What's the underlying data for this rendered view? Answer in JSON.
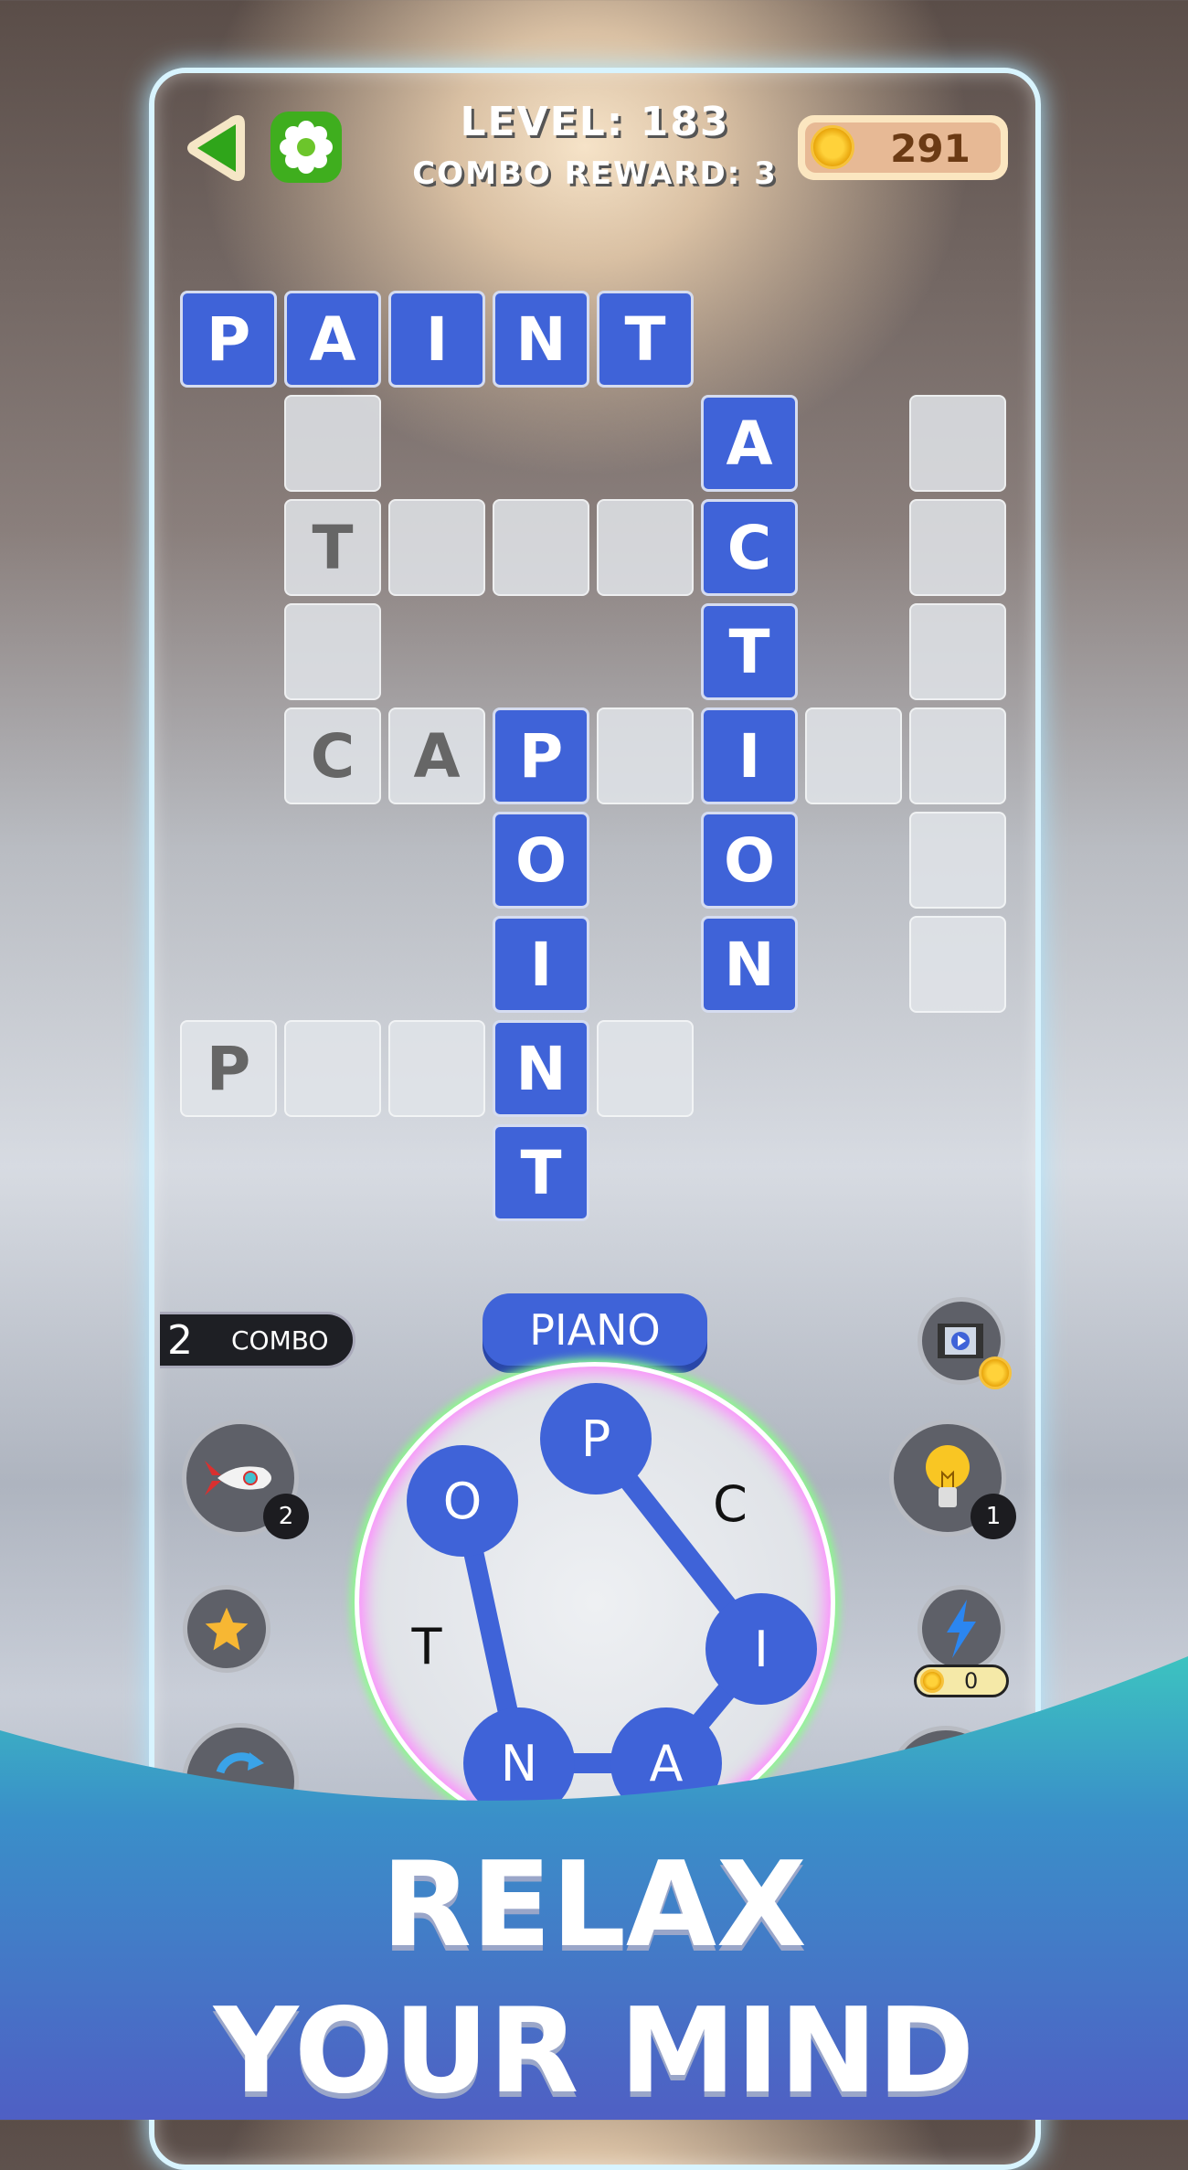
{
  "header": {
    "back_icon": "back-arrow-icon",
    "settings_icon": "gear-icon",
    "level": "LEVEL: 183",
    "combo_reward": "COMBO REWARD: 3",
    "coins": "291"
  },
  "grid": {
    "cells": [
      {
        "r": 0,
        "c": 0,
        "l": "P",
        "s": "filled"
      },
      {
        "r": 0,
        "c": 1,
        "l": "A",
        "s": "filled"
      },
      {
        "r": 0,
        "c": 2,
        "l": "I",
        "s": "filled"
      },
      {
        "r": 0,
        "c": 3,
        "l": "N",
        "s": "filled"
      },
      {
        "r": 0,
        "c": 4,
        "l": "T",
        "s": "filled"
      },
      {
        "r": 1,
        "c": 1,
        "l": "",
        "s": "empty"
      },
      {
        "r": 1,
        "c": 5,
        "l": "A",
        "s": "filled"
      },
      {
        "r": 1,
        "c": 7,
        "l": "",
        "s": "empty"
      },
      {
        "r": 2,
        "c": 1,
        "l": "T",
        "s": "hint"
      },
      {
        "r": 2,
        "c": 2,
        "l": "",
        "s": "empty"
      },
      {
        "r": 2,
        "c": 3,
        "l": "",
        "s": "empty"
      },
      {
        "r": 2,
        "c": 4,
        "l": "",
        "s": "empty"
      },
      {
        "r": 2,
        "c": 5,
        "l": "C",
        "s": "filled"
      },
      {
        "r": 2,
        "c": 7,
        "l": "",
        "s": "empty"
      },
      {
        "r": 3,
        "c": 1,
        "l": "",
        "s": "empty"
      },
      {
        "r": 3,
        "c": 5,
        "l": "T",
        "s": "filled"
      },
      {
        "r": 3,
        "c": 7,
        "l": "",
        "s": "empty"
      },
      {
        "r": 4,
        "c": 1,
        "l": "C",
        "s": "hint"
      },
      {
        "r": 4,
        "c": 2,
        "l": "A",
        "s": "hint"
      },
      {
        "r": 4,
        "c": 3,
        "l": "P",
        "s": "filled"
      },
      {
        "r": 4,
        "c": 4,
        "l": "",
        "s": "empty"
      },
      {
        "r": 4,
        "c": 5,
        "l": "I",
        "s": "filled"
      },
      {
        "r": 4,
        "c": 6,
        "l": "",
        "s": "empty"
      },
      {
        "r": 4,
        "c": 7,
        "l": "",
        "s": "empty"
      },
      {
        "r": 5,
        "c": 3,
        "l": "O",
        "s": "filled"
      },
      {
        "r": 5,
        "c": 5,
        "l": "O",
        "s": "filled"
      },
      {
        "r": 5,
        "c": 7,
        "l": "",
        "s": "empty"
      },
      {
        "r": 6,
        "c": 3,
        "l": "I",
        "s": "filled"
      },
      {
        "r": 6,
        "c": 5,
        "l": "N",
        "s": "filled"
      },
      {
        "r": 6,
        "c": 7,
        "l": "",
        "s": "empty"
      },
      {
        "r": 7,
        "c": 0,
        "l": "P",
        "s": "hint"
      },
      {
        "r": 7,
        "c": 1,
        "l": "",
        "s": "empty"
      },
      {
        "r": 7,
        "c": 2,
        "l": "",
        "s": "empty"
      },
      {
        "r": 7,
        "c": 3,
        "l": "N",
        "s": "filled"
      },
      {
        "r": 7,
        "c": 4,
        "l": "",
        "s": "empty"
      },
      {
        "r": 8,
        "c": 3,
        "l": "T",
        "s": "filled"
      }
    ]
  },
  "combo": {
    "count": "2",
    "label": "COMBO"
  },
  "current_word": "PIANO",
  "wheel": {
    "letters": [
      "P",
      "C",
      "I",
      "A",
      "N",
      "T",
      "O"
    ],
    "selected": [
      "P",
      "I",
      "A",
      "N",
      "O"
    ],
    "path": [
      "P",
      "I",
      "A",
      "N",
      "O"
    ]
  },
  "boosters": {
    "rocket": {
      "icon": "rocket-icon",
      "count": "2"
    },
    "star": {
      "icon": "star-icon"
    },
    "shuffle": {
      "icon": "shuffle-icon"
    },
    "video": {
      "icon": "video-coins-icon"
    },
    "hint": {
      "icon": "lightbulb-icon",
      "count": "1"
    },
    "lightning": {
      "icon": "lightning-icon",
      "cost": "0"
    }
  },
  "tagline": {
    "line1": "RELAX",
    "line2": "YOUR MIND"
  },
  "colors": {
    "tile_blue": "#3f63d8",
    "accent_green": "#3fae1e",
    "teal": "#3cc3c0"
  }
}
